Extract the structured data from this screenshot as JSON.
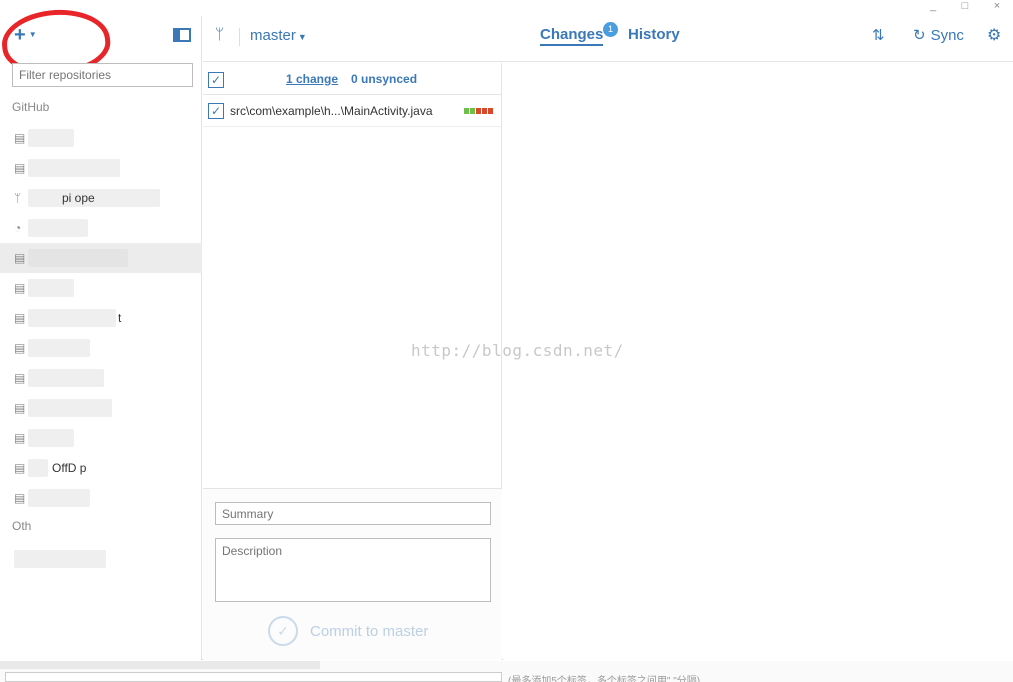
{
  "window": {
    "minimize": "_",
    "maximize": "□",
    "close": "×"
  },
  "sidebar": {
    "add_symbol": "+",
    "filter_placeholder": "Filter repositories",
    "group_github": "GitHub",
    "group_other": "Oth",
    "repos": [
      {
        "icon": "repo-icon",
        "label": ""
      },
      {
        "icon": "repo-icon",
        "label": ""
      },
      {
        "icon": "fork-icon",
        "label": "pi  ope"
      },
      {
        "icon": "history-icon",
        "label": ""
      },
      {
        "icon": "repo-icon",
        "label": "",
        "selected": true
      },
      {
        "icon": "repo-icon",
        "label": ""
      },
      {
        "icon": "repo-icon",
        "label": "t"
      },
      {
        "icon": "repo-icon",
        "label": ""
      },
      {
        "icon": "repo-icon",
        "label": ""
      },
      {
        "icon": "repo-icon",
        "label": ""
      },
      {
        "icon": "repo-icon",
        "label": ""
      },
      {
        "icon": "repo-icon",
        "label": "OffD  p"
      },
      {
        "icon": "repo-icon",
        "label": ""
      }
    ]
  },
  "toolbar": {
    "branch": "master",
    "tab_changes": "Changes",
    "changes_badge": "1",
    "tab_history": "History",
    "sync_label": "Sync"
  },
  "changes": {
    "count_label": "1 change",
    "unsynced_label": "0 unsynced",
    "files": [
      {
        "path": "src\\com\\example\\h...\\MainActivity.java",
        "checked": true
      }
    ],
    "summary_placeholder": "Summary",
    "description_placeholder": "Description",
    "commit_label": "Commit to master"
  },
  "watermark": "http://blog.csdn.net/",
  "page_strip": {
    "text": "(最多添加5个标签，多个标签之间用\",\"分隔)"
  },
  "colors": {
    "accent": "#3a78b8",
    "annotation": "#e8262a",
    "diff_add": "#6cc04a",
    "diff_del": "#d9482b"
  }
}
